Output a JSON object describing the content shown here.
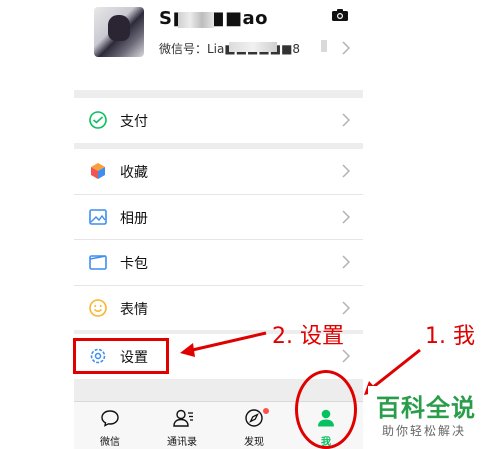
{
  "profile": {
    "name": "S■■■■ao",
    "wechat_id": "微信号：Lia■■■■■■8",
    "camera_icon": "camera-icon"
  },
  "menu": {
    "pay": "支付",
    "favorites": "收藏",
    "album": "相册",
    "cards": "卡包",
    "stickers": "表情",
    "settings": "设置"
  },
  "tabs": [
    {
      "label": "微信",
      "icon": "chat-icon"
    },
    {
      "label": "通讯录",
      "icon": "contacts-icon"
    },
    {
      "label": "发现",
      "icon": "discover-icon"
    },
    {
      "label": "我",
      "icon": "me-icon"
    }
  ],
  "annotations": {
    "step1": "1. 我",
    "step2": "2. 设置"
  },
  "watermark": {
    "title": "百科全说",
    "subtitle": "助你轻松解决"
  },
  "colors": {
    "accent": "#07c160",
    "annotation": "#e00000",
    "watermark": "#2a9d4a"
  }
}
